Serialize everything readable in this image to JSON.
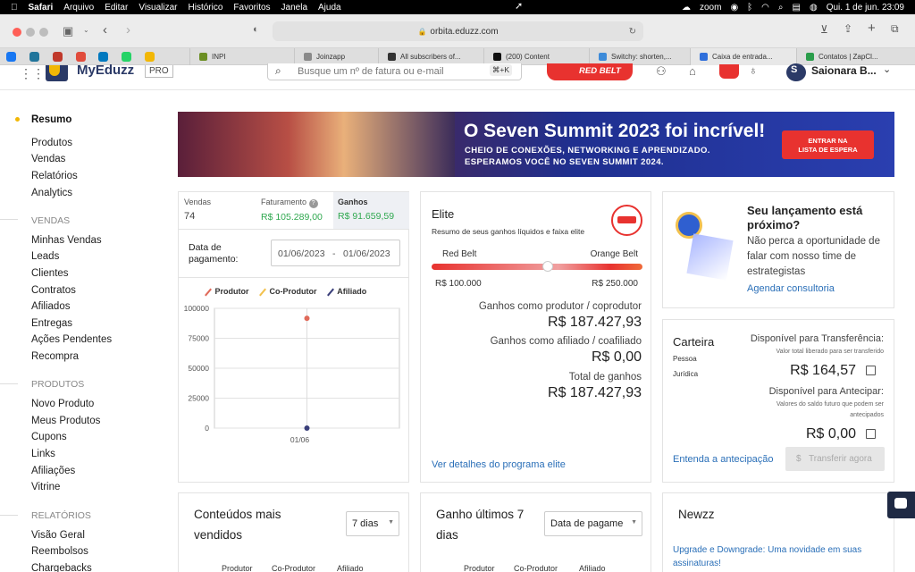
{
  "mac": {
    "app": "Safari",
    "menus": [
      "Arquivo",
      "Editar",
      "Visualizar",
      "Histórico",
      "Favoritos",
      "Janela",
      "Ajuda"
    ],
    "zoom": "zoom",
    "datetime": "Qui. 1 de jun.  23:09"
  },
  "browser": {
    "url": "orbita.eduzz.com",
    "tabs": [
      {
        "label": "INPI",
        "color": "#6b8e23"
      },
      {
        "label": "Joinzapp",
        "color": "#8a8a8a"
      },
      {
        "label": "All subscribers of...",
        "color": "#333"
      },
      {
        "label": "(200) Content",
        "color": "#111"
      },
      {
        "label": "Switchy: shorten,...",
        "color": "#3d8bd9"
      },
      {
        "label": "Caixa de entrada...",
        "color": "#2f6fdb"
      },
      {
        "label": "Contatos | ZapCl...",
        "color": "#2a9d4b"
      }
    ]
  },
  "header": {
    "brand": "MyEduzz",
    "badge": "PRO",
    "search_placeholder": "Busque um nº de fatura ou e-mail",
    "shortcut": "⌘+K",
    "redbelt": "RED BELT",
    "user": "Saionara B..."
  },
  "sidebar": {
    "active": "Resumo",
    "group1": [
      "Produtos",
      "Vendas",
      "Relatórios",
      "Analytics"
    ],
    "vendas_title": "VENDAS",
    "vendas": [
      "Minhas Vendas",
      "Leads",
      "Clientes",
      "Contratos",
      "Afiliados",
      "Entregas",
      "Ações Pendentes",
      "Recompra"
    ],
    "produtos_title": "PRODUTOS",
    "produtos": [
      "Novo Produto",
      "Meus Produtos",
      "Cupons",
      "Links",
      "Afiliações",
      "Vitrine"
    ],
    "relatorios_title": "RELATÓRIOS",
    "relatorios": [
      "Visão Geral",
      "Reembolsos",
      "Chargebacks"
    ]
  },
  "banner": {
    "title": "O Seven Summit 2023 foi incrível!",
    "line1": "CHEIO DE CONEXÕES, NETWORKING E APRENDIZADO.",
    "line2": "ESPERAMOS VOCÊ NO SEVEN SUMMIT 2024.",
    "cta1": "ENTRAR NA",
    "cta2": "LISTA DE ESPERA"
  },
  "sales": {
    "vendas_label": "Vendas",
    "vendas_value": "74",
    "fat_label": "Faturamento",
    "fat_value": "R$ 105.289,00",
    "ganhos_label": "Ganhos",
    "ganhos_value": "R$ 91.659,59",
    "date_label": "Data de pagamento:",
    "date_from": "01/06/2023",
    "date_sep": "-",
    "date_to": "01/06/2023"
  },
  "chart_data": {
    "type": "scatter",
    "legend": [
      "Produtor",
      "Co-Produtor",
      "Afiliado"
    ],
    "colors": {
      "Produtor": "#e06a5a",
      "Co-Produtor": "#f2c14e",
      "Afiliado": "#3a3f7a"
    },
    "categories": [
      "01/06"
    ],
    "series": [
      {
        "name": "Produtor",
        "values": [
          91659
        ]
      },
      {
        "name": "Afiliado",
        "values": [
          0
        ]
      }
    ],
    "ylim": [
      0,
      100000
    ],
    "yticks": [
      0,
      25000,
      50000,
      75000,
      100000
    ],
    "grid": true
  },
  "elite": {
    "title": "Elite",
    "subtitle": "Resumo de seus ganhos líquidos e faixa elite",
    "left_label": "Red Belt",
    "right_label": "Orange Belt",
    "left_value": "R$ 100.000",
    "right_value": "R$ 250.000",
    "progress": 0.55,
    "prod_label": "Ganhos como produtor / coprodutor",
    "prod_value": "R$ 187.427,93",
    "afil_label": "Ganhos como afiliado / coafiliado",
    "afil_value": "R$ 0,00",
    "total_label": "Total de ganhos",
    "total_value": "R$ 187.427,93",
    "link": "Ver detalhes do programa elite"
  },
  "launch": {
    "title": "Seu lançamento está próximo?",
    "text": "Não perca a oportunidade de falar com nosso time de estrategistas",
    "link": "Agendar consultoria"
  },
  "wallet": {
    "title": "Carteira",
    "pessoa": "Pessoa",
    "juridica": "Jurídica",
    "transfer_label": "Disponível para Transferência:",
    "transfer_note": "Valor total liberado para ser transferido",
    "transfer_value": "R$ 164,57",
    "antecipar_label": "Disponível para Antecipar:",
    "antecipar_note1": "Valores do saldo futuro que podem ser",
    "antecipar_note2": "antecipados",
    "antecipar_value": "R$ 0,00",
    "link": "Entenda a antecipação",
    "button": "Transferir agora"
  },
  "conteudos": {
    "title1": "Conteúdos mais",
    "title2": "vendidos",
    "select": "7 dias",
    "cols": [
      "Produtor",
      "Co-Produtor",
      "Afiliado"
    ]
  },
  "ganho": {
    "title1": "Ganho últimos 7",
    "title2": "dias",
    "select": "Data de pagame",
    "cols": [
      "Produtor",
      "Co-Produtor",
      "Afiliado"
    ]
  },
  "news": {
    "title": "Newzz",
    "item1": "Upgrade e Downgrade: Uma novidade em suas",
    "item2": "assinaturas!"
  }
}
